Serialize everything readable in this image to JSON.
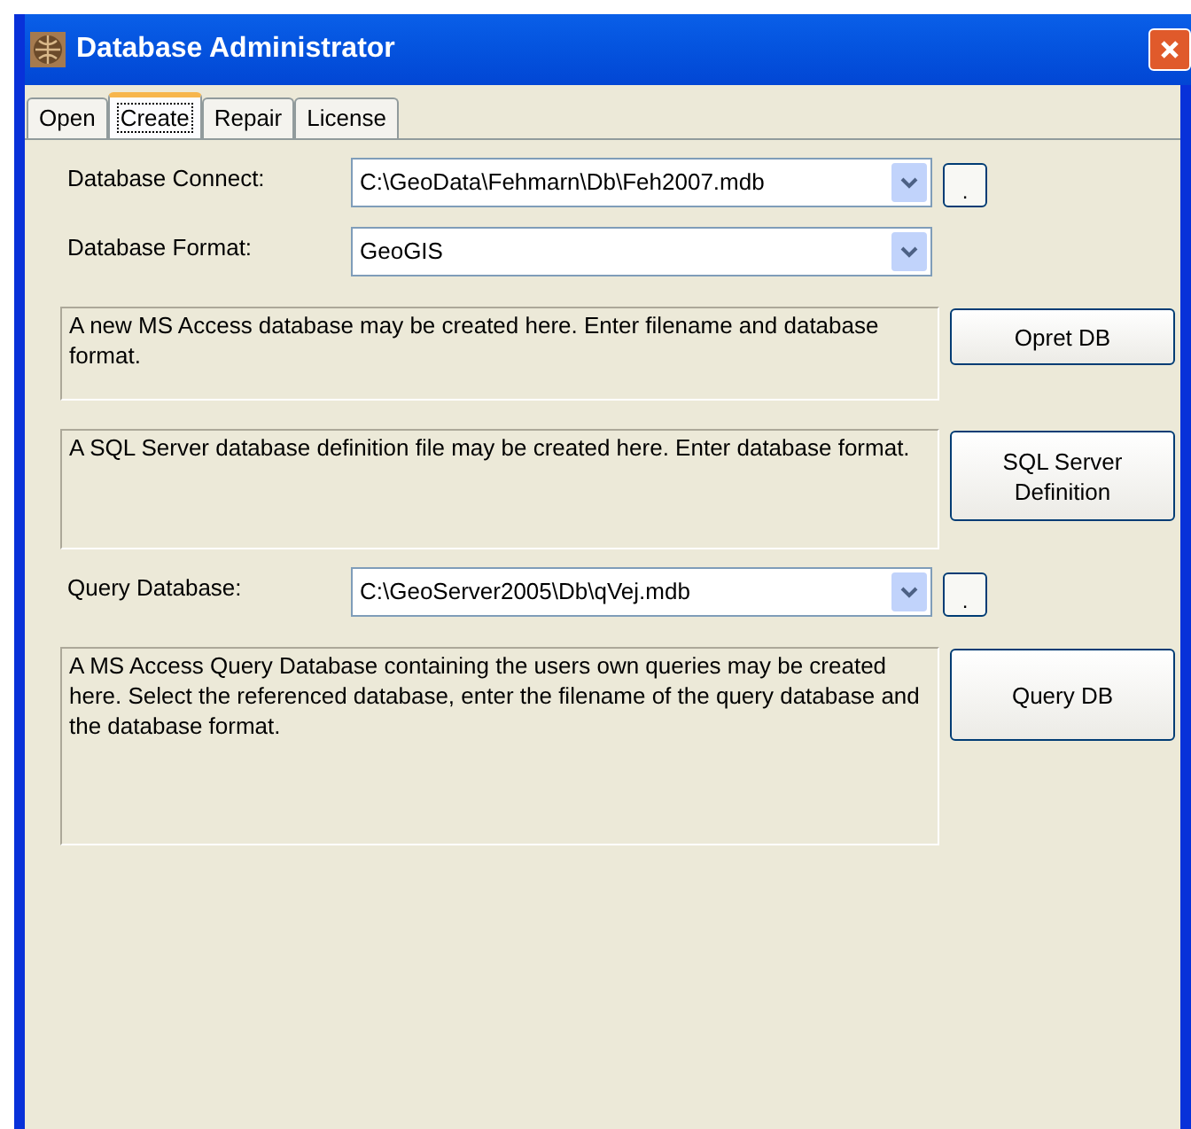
{
  "window": {
    "title": "Database Administrator"
  },
  "tabs": [
    {
      "label": "Open",
      "selected": false
    },
    {
      "label": "Create",
      "selected": true
    },
    {
      "label": "Repair",
      "selected": false
    },
    {
      "label": "License",
      "selected": false
    }
  ],
  "rows": [
    {
      "kind": "combo",
      "label": "Database Connect:",
      "value": "C:\\GeoData\\Fehmarn\\Db\\Feh2007.mdb",
      "browse": "."
    },
    {
      "kind": "combo",
      "label": "Database Format:",
      "value": "GeoGIS"
    },
    {
      "kind": "action",
      "description": "A new MS Access database may be created here. Enter filename and database format.",
      "button": "Opret DB"
    },
    {
      "kind": "action",
      "description": "A SQL Server database definition file may be created here. Enter database format.",
      "button": "SQL Server Definition"
    },
    {
      "kind": "combo",
      "label": "Query Database:",
      "value": "C:\\GeoServer2005\\Db\\qVej.mdb",
      "browse": "."
    },
    {
      "kind": "action",
      "description": "A MS Access Query Database containing the users own queries may be created here. Select the referenced database, enter the filename of the query database and the database format.",
      "button": "Query DB"
    }
  ]
}
